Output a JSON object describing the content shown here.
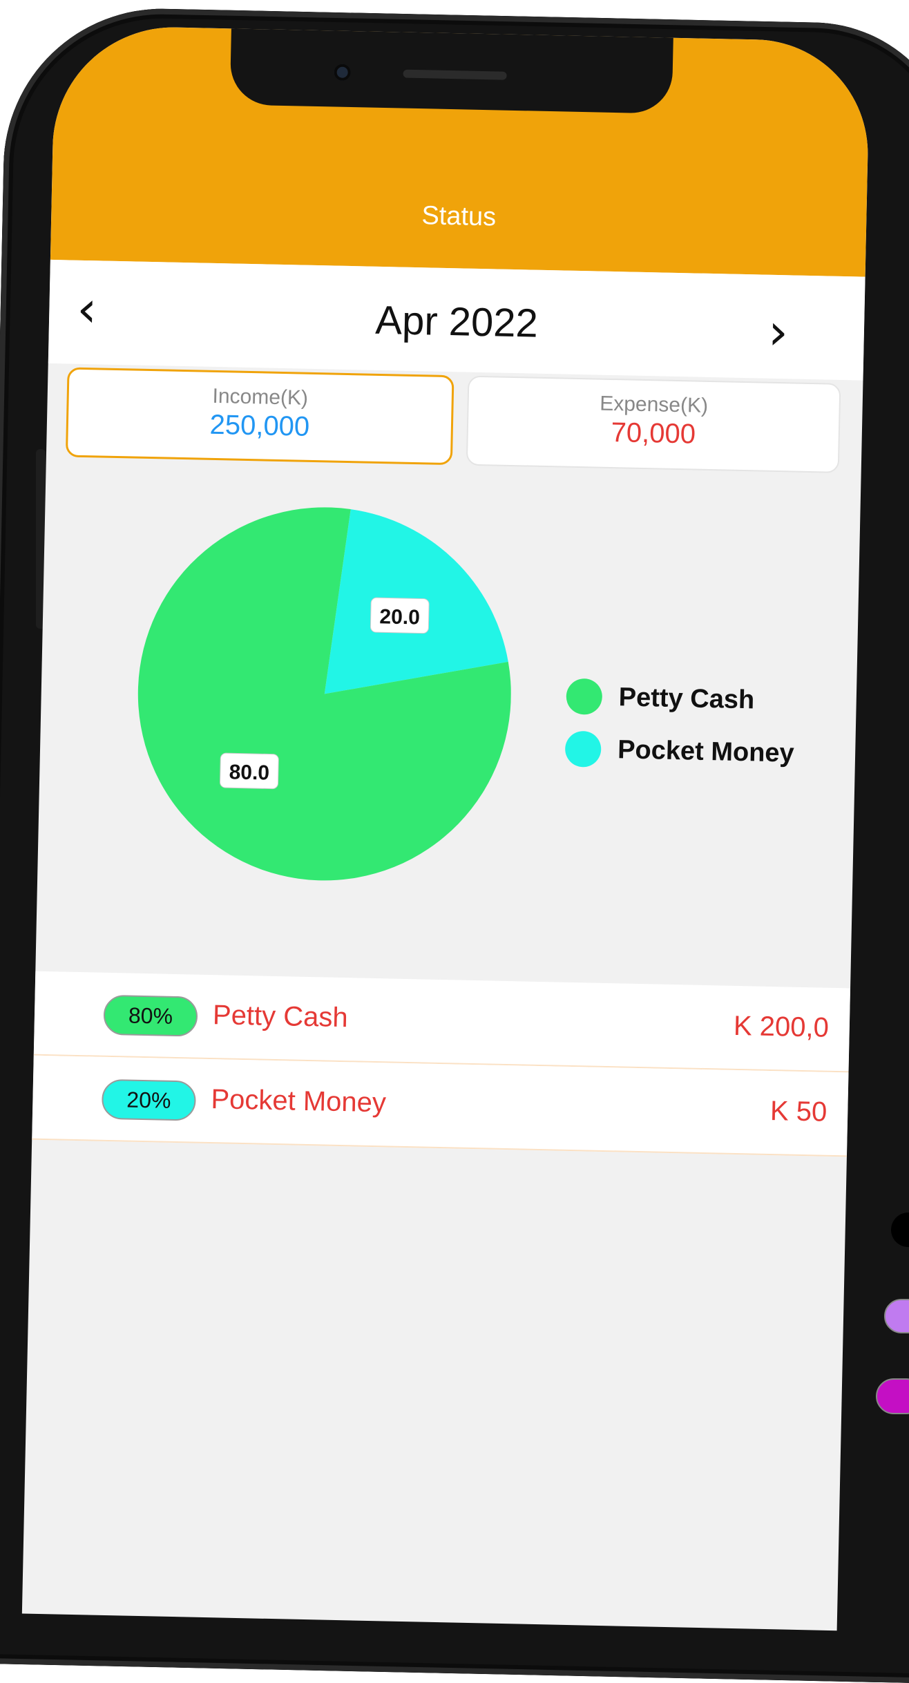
{
  "header": {
    "title": "Status"
  },
  "month_nav": {
    "prev_label": "‹",
    "month": "Apr 2022",
    "next_label": "›"
  },
  "summary": {
    "income_label": "Income(K)",
    "income_value": "250,000",
    "expense_label": "Expense(K)",
    "expense_value": "70,000"
  },
  "chart_data": {
    "type": "pie",
    "slices": [
      {
        "label": "Petty Cash",
        "value": 80.0,
        "value_label": "80.0",
        "color": "#33e872"
      },
      {
        "label": "Pocket Money",
        "value": 20.0,
        "value_label": "20.0",
        "color": "#22f5e6"
      }
    ],
    "legend_position": "right"
  },
  "legend": [
    {
      "label": "Petty Cash",
      "color": "#33e872"
    },
    {
      "label": "Pocket Money",
      "color": "#22f5e6"
    }
  ],
  "rows": [
    {
      "percent": "80%",
      "name": "Petty Cash",
      "amount": "K 200,0",
      "color": "#33e872"
    },
    {
      "percent": "20%",
      "name": "Pocket Money",
      "amount": "K 50",
      "color": "#22f5e6"
    }
  ],
  "colors": {
    "header": "#f0a30a",
    "income": "#2196f3",
    "expense": "#e53935",
    "background": "#f1f1f1"
  }
}
